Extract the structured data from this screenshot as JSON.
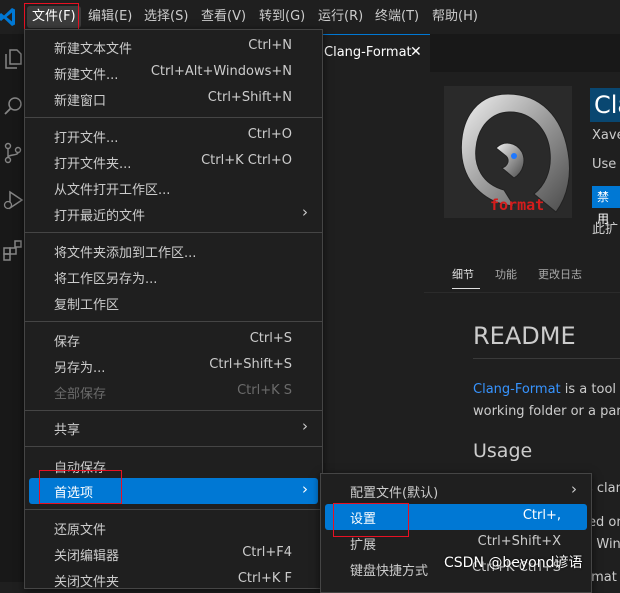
{
  "menubar": {
    "items": [
      "文件(F)",
      "编辑(E)",
      "选择(S)",
      "查看(V)",
      "转到(G)",
      "运行(R)",
      "终端(T)",
      "帮助(H)"
    ]
  },
  "activity_icons": [
    "explorer-icon",
    "search-icon",
    "source-control-icon",
    "run-debug-icon",
    "extensions-icon"
  ],
  "editor": {
    "tab_label": "Clang-Format",
    "tab_close": "✕",
    "extension": {
      "logo_text": "format",
      "title": "Cla",
      "author": "Xave",
      "desc": "Use",
      "button": "禁用",
      "note": "此扩",
      "tabs": [
        "细节",
        "功能",
        "更改日志"
      ]
    },
    "readme": {
      "heading": "README",
      "p1_link": "Clang-Format",
      "p1_rest": " is a tool to",
      "p2": "working folder or a parent",
      "usage": "Usage",
      "frag1": "s clan",
      "frag2": "ed on",
      "frag3": "n Wind",
      "frag4": "rmat a"
    }
  },
  "file_menu": {
    "items": [
      {
        "label": "新建文本文件",
        "shortcut": "Ctrl+N"
      },
      {
        "label": "新建文件...",
        "shortcut": "Ctrl+Alt+Windows+N"
      },
      {
        "label": "新建窗口",
        "shortcut": "Ctrl+Shift+N"
      },
      {
        "label": "打开文件...",
        "shortcut": "Ctrl+O"
      },
      {
        "label": "打开文件夹...",
        "shortcut": "Ctrl+K Ctrl+O"
      },
      {
        "label": "从文件打开工作区...",
        "shortcut": ""
      },
      {
        "label": "打开最近的文件",
        "shortcut": "",
        "submenu": true
      },
      {
        "label": "将文件夹添加到工作区...",
        "shortcut": ""
      },
      {
        "label": "将工作区另存为...",
        "shortcut": ""
      },
      {
        "label": "复制工作区",
        "shortcut": ""
      },
      {
        "label": "保存",
        "shortcut": "Ctrl+S"
      },
      {
        "label": "另存为...",
        "shortcut": "Ctrl+Shift+S"
      },
      {
        "label": "全部保存",
        "shortcut": "Ctrl+K S",
        "disabled": true
      },
      {
        "label": "共享",
        "shortcut": "",
        "submenu": true
      },
      {
        "label": "自动保存",
        "shortcut": ""
      },
      {
        "label": "首选项",
        "shortcut": "",
        "submenu": true,
        "highlighted": true
      },
      {
        "label": "还原文件",
        "shortcut": ""
      },
      {
        "label": "关闭编辑器",
        "shortcut": "Ctrl+F4"
      },
      {
        "label": "关闭文件夹",
        "shortcut": "Ctrl+K F"
      }
    ]
  },
  "pref_menu": {
    "items": [
      {
        "label": "配置文件(默认)",
        "shortcut": "",
        "submenu": true
      },
      {
        "label": "设置",
        "shortcut": "Ctrl+,",
        "highlighted": true
      },
      {
        "label": "扩展",
        "shortcut": "Ctrl+Shift+X"
      },
      {
        "label": "键盘快捷方式",
        "shortcut": "Ctrl+K Ctrl+S"
      }
    ]
  },
  "watermark": "CSDN @beyond谚语",
  "colors": {
    "accent": "#0078d4",
    "highlight_box": "#e81123",
    "link": "#3794ff"
  }
}
